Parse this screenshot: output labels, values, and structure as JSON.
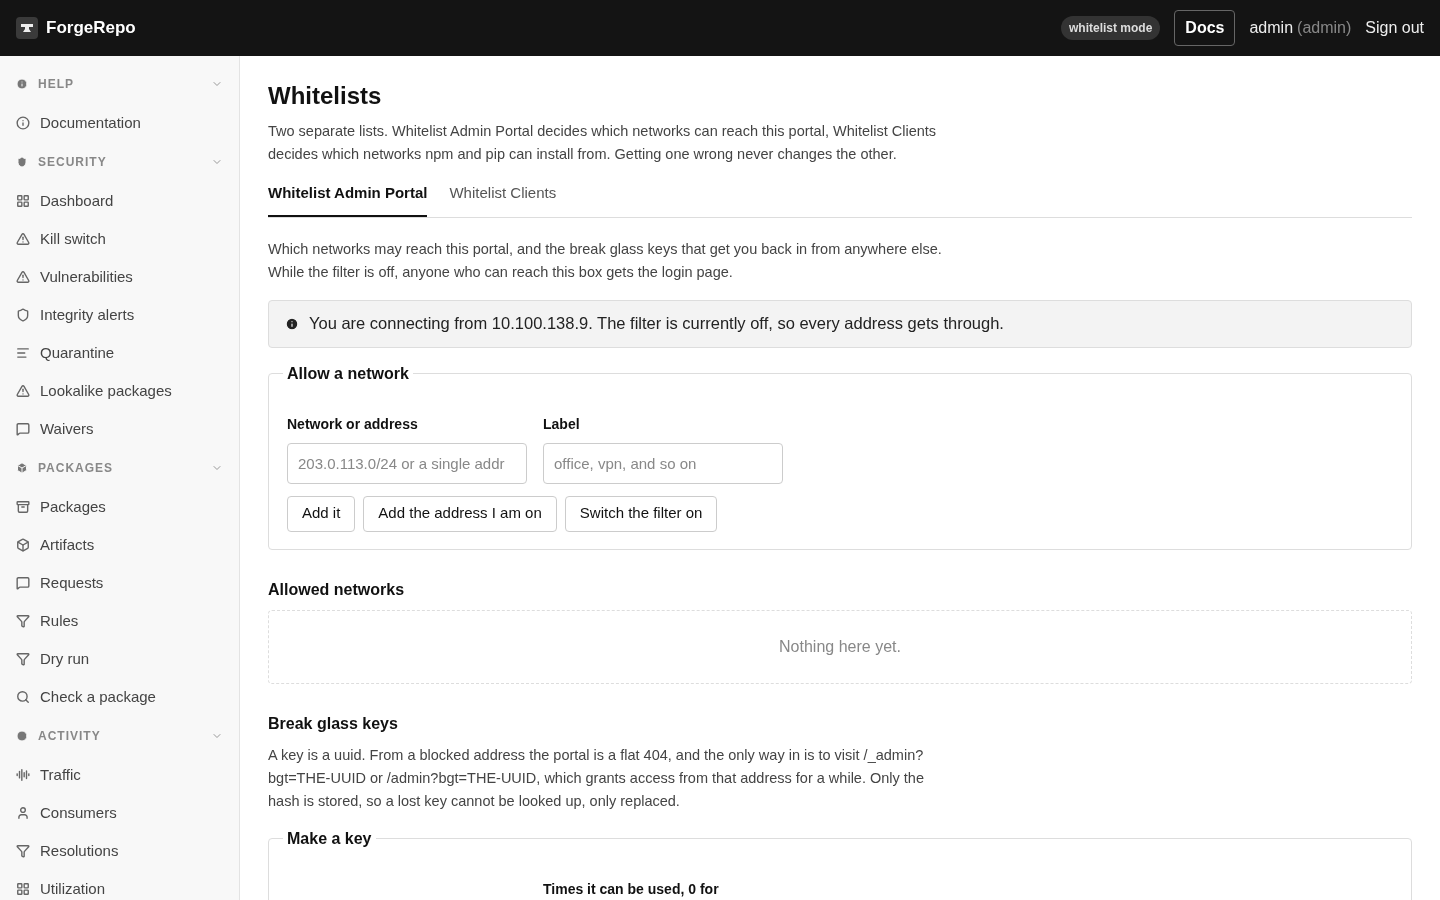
{
  "header": {
    "brand": "ForgeRepo",
    "mode_badge": "whitelist mode",
    "docs_button": "Docs",
    "user": "admin",
    "role": "(admin)",
    "sign_out": "Sign out"
  },
  "sidebar": {
    "sections": [
      {
        "title": "HELP",
        "expanded": true,
        "items": [
          {
            "label": "Documentation",
            "selected": false
          }
        ]
      },
      {
        "title": "SECURITY",
        "expanded": true,
        "items": [
          {
            "label": "Dashboard",
            "selected": false
          },
          {
            "label": "Kill switch",
            "selected": false
          },
          {
            "label": "Vulnerabilities",
            "selected": false
          },
          {
            "label": "Integrity alerts",
            "selected": false
          },
          {
            "label": "Quarantine",
            "selected": false
          },
          {
            "label": "Lookalike packages",
            "selected": false
          },
          {
            "label": "Waivers",
            "selected": false
          }
        ]
      },
      {
        "title": "PACKAGES",
        "expanded": true,
        "items": [
          {
            "label": "Packages",
            "selected": false
          },
          {
            "label": "Artifacts",
            "selected": false
          },
          {
            "label": "Requests",
            "selected": false
          },
          {
            "label": "Rules",
            "selected": false
          },
          {
            "label": "Dry run",
            "selected": false
          },
          {
            "label": "Check a package",
            "selected": false
          }
        ]
      },
      {
        "title": "ACTIVITY",
        "expanded": true,
        "items": [
          {
            "label": "Traffic",
            "selected": false
          },
          {
            "label": "Consumers",
            "selected": false
          },
          {
            "label": "Resolutions",
            "selected": false
          },
          {
            "label": "Utilization",
            "selected": false
          }
        ]
      }
    ]
  },
  "page": {
    "title": "Whitelists",
    "intro": "Two separate lists. Whitelist Admin Portal decides which networks can reach this portal, Whitelist Clients decides which networks npm and pip can install from. Getting one wrong never changes the other.",
    "tabs": [
      {
        "label": "Whitelist Admin Portal",
        "selected": true
      },
      {
        "label": "Whitelist Clients",
        "selected": false
      }
    ],
    "tab_intro": "Which networks may reach this portal, and the break glass keys that get you back in from anywhere else. While the filter is off, anyone who can reach this box gets the login page.",
    "notice": "You are connecting from 10.100.138.9. The filter is currently off, so every address gets through.",
    "allow_form": {
      "legend": "Allow a network",
      "fields": [
        {
          "label": "Network or address",
          "placeholder": "203.0.113.0/24 or a single addr"
        },
        {
          "label": "Label",
          "placeholder": "office, vpn, and so on"
        }
      ],
      "buttons": [
        "Add it",
        "Add the address I am on",
        "Switch the filter on"
      ]
    },
    "allowed": {
      "title": "Allowed networks",
      "empty": "Nothing here yet."
    },
    "keys": {
      "title": "Break glass keys",
      "description": "A key is a uuid. From a blocked address the portal is a flat 404, and the only way in is to visit /_admin?bgt=THE-UUID or /admin?bgt=THE-UUID, which grants access from that address for a while. Only the hash is stored, so a lost key cannot be looked up, only replaced.",
      "form_legend": "Make a key",
      "field_label": "Times it can be used, 0 for"
    }
  }
}
